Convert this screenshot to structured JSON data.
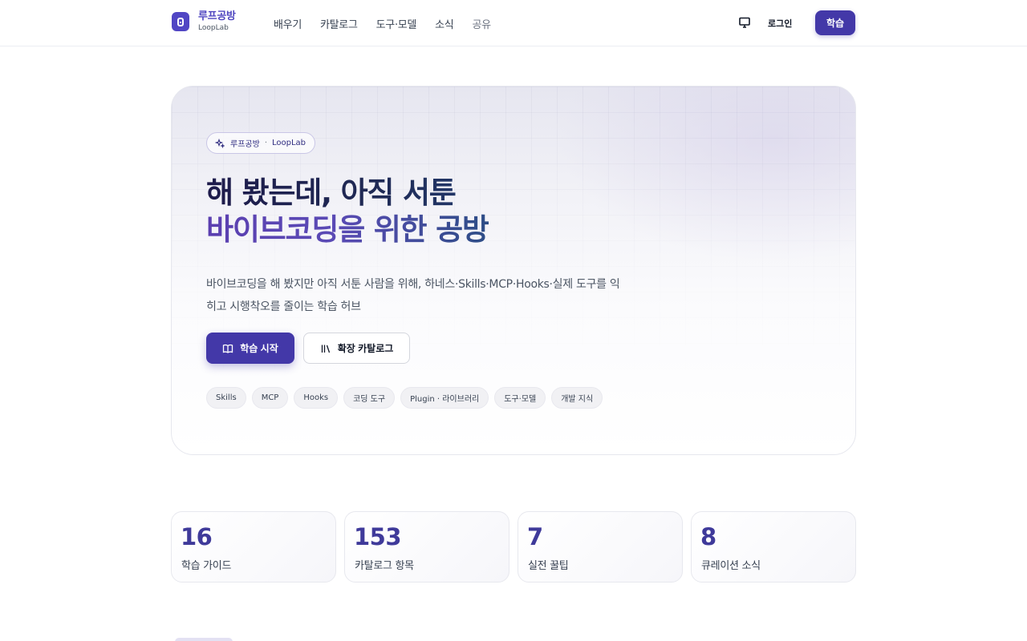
{
  "header": {
    "logo_name": "루프공방",
    "logo_sub": "LoopLab",
    "nav": [
      "배우기",
      "카탈로그",
      "도구·모델",
      "소식",
      "공유"
    ],
    "login": "로그인",
    "learn_button": "학습"
  },
  "hero": {
    "badge_left": "루프공방",
    "badge_sep": "·",
    "badge_right": "LoopLab",
    "headline_line1": "해 봤는데, 아직 서툰",
    "headline_line2": "바이브코딩을 위한 공방",
    "description": "바이브코딩을 해 봤지만 아직 서툰 사람을 위해, 하네스·Skills·MCP·Hooks·실제 도구를 익히고 시행착오를 줄이는 학습 허브",
    "cta_primary": "학습 시작",
    "cta_secondary": "확장 카탈로그",
    "tags": [
      "Skills",
      "MCP",
      "Hooks",
      "코딩 도구",
      "Plugin · 라이브러리",
      "도구·모델",
      "개발 지식"
    ]
  },
  "stats": [
    {
      "value": "16",
      "label": "학습 가이드"
    },
    {
      "value": "153",
      "label": "카탈로그 항목"
    },
    {
      "value": "7",
      "label": "실전 꿀팁"
    },
    {
      "value": "8",
      "label": "큐레이션 소식"
    }
  ],
  "colors": {
    "accent": "#4338a8",
    "stat_number": "#3f3a9a",
    "heading_dark": "#1e1b4b",
    "heading_purple": "#5b3fb0"
  }
}
